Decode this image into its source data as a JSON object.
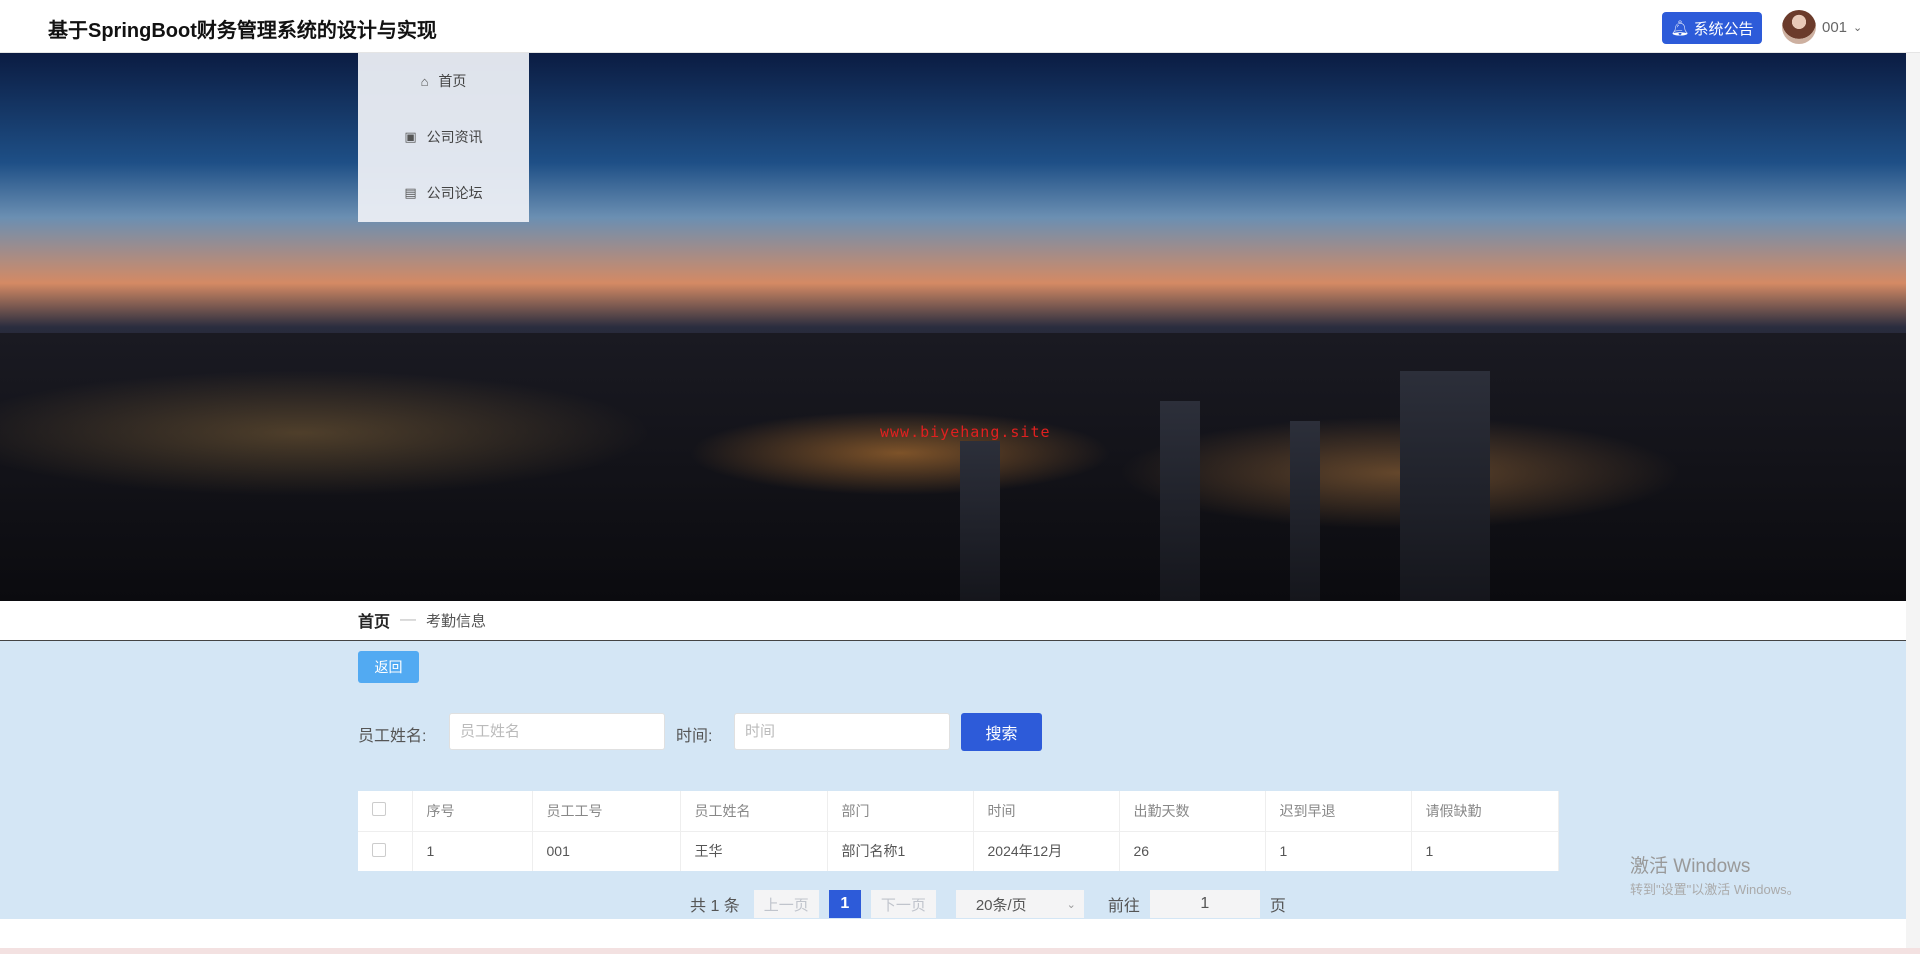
{
  "header": {
    "title": "基于SpringBoot财务管理系统的设计与实现",
    "notice_label": "系统公告",
    "username": "001"
  },
  "banner": {
    "watermark": "www.biyehang.site"
  },
  "nav": {
    "items": [
      {
        "label": "首页",
        "icon": "home-icon"
      },
      {
        "label": "公司资讯",
        "icon": "news-icon"
      },
      {
        "label": "公司论坛",
        "icon": "forum-icon"
      }
    ]
  },
  "breadcrumb": {
    "home": "首页",
    "separator": "—",
    "current": "考勤信息"
  },
  "back_label": "返回",
  "search": {
    "name_label": "员工姓名:",
    "name_placeholder": "员工姓名",
    "time_label": "时间:",
    "time_placeholder": "时间",
    "button": "搜索"
  },
  "table": {
    "headers": [
      "序号",
      "员工工号",
      "员工姓名",
      "部门",
      "时间",
      "出勤天数",
      "迟到早退",
      "请假缺勤"
    ],
    "rows": [
      [
        "1",
        "001",
        "王华",
        "部门名称1",
        "2024年12月",
        "26",
        "1",
        "1"
      ]
    ]
  },
  "pagination": {
    "total": "共 1 条",
    "prev": "上一页",
    "page": "1",
    "next": "下一页",
    "page_size": "20条/页",
    "goto_label": "前往",
    "goto_value": "1",
    "page_unit": "页"
  },
  "windows": {
    "line1": "激活 Windows",
    "line2": "转到\"设置\"以激活 Windows。"
  }
}
